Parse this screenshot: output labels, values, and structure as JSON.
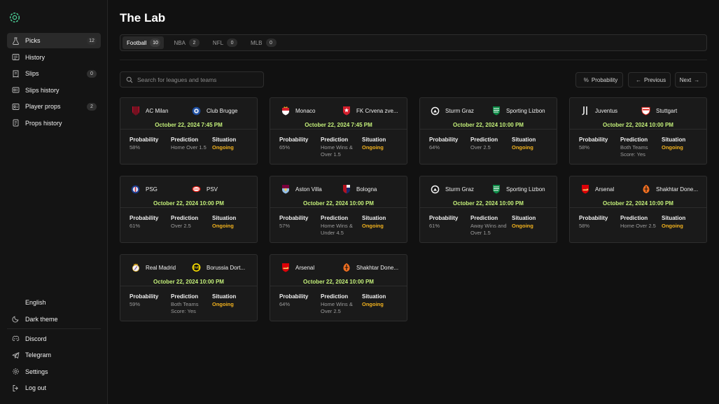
{
  "app": {
    "title": "The Lab"
  },
  "sidebar": {
    "items": [
      {
        "label": "Picks",
        "icon": "flask-icon",
        "count": "12",
        "active": true
      },
      {
        "label": "History",
        "icon": "history-icon"
      },
      {
        "label": "Slips",
        "icon": "receipt-icon",
        "count": "0"
      },
      {
        "label": "Slips history",
        "icon": "slips-history-icon"
      },
      {
        "label": "Player props",
        "icon": "player-props-icon",
        "count": "2"
      },
      {
        "label": "Props history",
        "icon": "props-history-icon"
      }
    ],
    "bottom": {
      "language": "English",
      "theme": "Dark theme",
      "discord": "Discord",
      "telegram": "Telegram",
      "settings": "Settings",
      "logout": "Log out"
    }
  },
  "tabs": [
    {
      "label": "Football",
      "count": "10",
      "active": true
    },
    {
      "label": "NBA",
      "count": "2"
    },
    {
      "label": "NFL",
      "count": "0"
    },
    {
      "label": "MLB",
      "count": "0"
    }
  ],
  "search": {
    "placeholder": "Search for leagues and teams"
  },
  "controls": {
    "probability": "Probability",
    "previous": "Previous",
    "next": "Next"
  },
  "labels": {
    "probability": "Probability",
    "prediction": "Prediction",
    "situation": "Situation"
  },
  "colors": {
    "accent_date": "#c4f07a",
    "ongoing": "#f2b21e",
    "background": "#111111",
    "card": "#1a1a1a"
  },
  "matches": [
    {
      "home": "AC Milan",
      "away": "Club Brugge",
      "home_icon": "ac-milan-crest-icon",
      "away_icon": "club-brugge-crest-icon",
      "date": "October 22, 2024 7:45 PM",
      "probability": "58%",
      "prediction": "Home Over 1.5",
      "situation": "Ongoing"
    },
    {
      "home": "Monaco",
      "away": "FK Crvena zve...",
      "home_icon": "monaco-crest-icon",
      "away_icon": "crvena-zvezda-crest-icon",
      "date": "October 22, 2024 7:45 PM",
      "probability": "65%",
      "prediction": "Home Wins & Over 1.5",
      "situation": "Ongoing"
    },
    {
      "home": "Sturm Graz",
      "away": "Sporting Lizbon",
      "home_icon": "sturm-graz-crest-icon",
      "away_icon": "sporting-crest-icon",
      "date": "October 22, 2024 10:00 PM",
      "probability": "64%",
      "prediction": "Over 2.5",
      "situation": "Ongoing"
    },
    {
      "home": "Juventus",
      "away": "Stuttgart",
      "home_icon": "juventus-crest-icon",
      "away_icon": "stuttgart-crest-icon",
      "date": "October 22, 2024 10:00 PM",
      "probability": "58%",
      "prediction": "Both Teams Score: Yes",
      "situation": "Ongoing"
    },
    {
      "home": "PSG",
      "away": "PSV",
      "home_icon": "psg-crest-icon",
      "away_icon": "psv-crest-icon",
      "date": "October 22, 2024 10:00 PM",
      "probability": "61%",
      "prediction": "Over 2.5",
      "situation": "Ongoing"
    },
    {
      "home": "Aston Villa",
      "away": "Bologna",
      "home_icon": "aston-villa-crest-icon",
      "away_icon": "bologna-crest-icon",
      "date": "October 22, 2024 10:00 PM",
      "probability": "57%",
      "prediction": "Home Wins & Under 4.5",
      "situation": "Ongoing"
    },
    {
      "home": "Sturm Graz",
      "away": "Sporting Lizbon",
      "home_icon": "sturm-graz-crest-icon",
      "away_icon": "sporting-crest-icon",
      "date": "October 22, 2024 10:00 PM",
      "probability": "61%",
      "prediction": "Away Wins and Over 1.5",
      "situation": "Ongoing"
    },
    {
      "home": "Arsenal",
      "away": "Shakhtar Done...",
      "home_icon": "arsenal-crest-icon",
      "away_icon": "shakhtar-crest-icon",
      "date": "October 22, 2024 10:00 PM",
      "probability": "58%",
      "prediction": "Home Over 2.5",
      "situation": "Ongoing"
    },
    {
      "home": "Real Madrid",
      "away": "Borussia Dort...",
      "home_icon": "real-madrid-crest-icon",
      "away_icon": "dortmund-crest-icon",
      "date": "October 22, 2024 10:00 PM",
      "probability": "59%",
      "prediction": "Both Teams Score: Yes",
      "situation": "Ongoing"
    },
    {
      "home": "Arsenal",
      "away": "Shakhtar Done...",
      "home_icon": "arsenal-crest-icon",
      "away_icon": "shakhtar-crest-icon",
      "date": "October 22, 2024 10:00 PM",
      "probability": "64%",
      "prediction": "Home Wins & Over 2.5",
      "situation": "Ongoing"
    }
  ]
}
